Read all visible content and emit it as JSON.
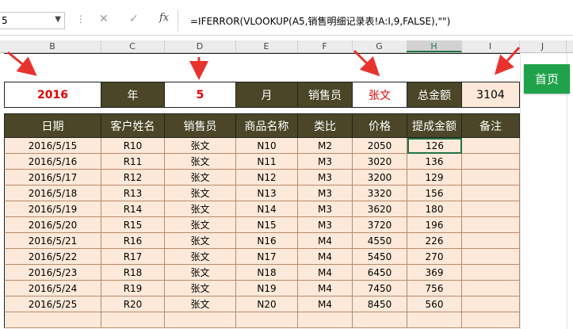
{
  "formula_bar": {
    "name_box": "5",
    "cancel_icon": "✕",
    "enter_icon": "✓",
    "fx_label": "fx",
    "formula": "=IFERROR(VLOOKUP(A5,销售明细记录表!A:I,9,FALSE),\"\")"
  },
  "columns": [
    "B",
    "C",
    "D",
    "E",
    "F",
    "G",
    "H",
    "I",
    "J"
  ],
  "selected_column": "H",
  "info_row": {
    "year_value": "2016",
    "year_label": "年",
    "month_value": "5",
    "month_label": "月",
    "seller_label": "销售员",
    "seller_value": "张文",
    "total_label": "总金额",
    "total_value": "3104"
  },
  "home_button": "首页",
  "table": {
    "headers": [
      "日期",
      "客户姓名",
      "销售员",
      "商品名称",
      "类比",
      "价格",
      "提成金额",
      "备注"
    ],
    "rows": [
      [
        "2016/5/15",
        "R10",
        "张文",
        "N10",
        "M2",
        "2050",
        "126",
        ""
      ],
      [
        "2016/5/16",
        "R11",
        "张文",
        "N11",
        "M3",
        "3020",
        "136",
        ""
      ],
      [
        "2016/5/17",
        "R12",
        "张文",
        "N12",
        "M3",
        "3200",
        "129",
        ""
      ],
      [
        "2016/5/18",
        "R13",
        "张文",
        "N13",
        "M3",
        "3320",
        "156",
        ""
      ],
      [
        "2016/5/19",
        "R14",
        "张文",
        "N14",
        "M3",
        "3620",
        "180",
        ""
      ],
      [
        "2016/5/20",
        "R15",
        "张文",
        "N15",
        "M3",
        "3720",
        "196",
        ""
      ],
      [
        "2016/5/21",
        "R16",
        "张文",
        "N16",
        "M4",
        "4550",
        "226",
        ""
      ],
      [
        "2016/5/22",
        "R17",
        "张文",
        "N17",
        "M4",
        "5450",
        "270",
        ""
      ],
      [
        "2016/5/23",
        "R18",
        "张文",
        "N18",
        "M4",
        "6450",
        "369",
        ""
      ],
      [
        "2016/5/24",
        "R19",
        "张文",
        "N19",
        "M4",
        "7450",
        "756",
        ""
      ],
      [
        "2016/5/25",
        "R20",
        "张文",
        "N20",
        "M4",
        "8450",
        "560",
        ""
      ],
      [
        "",
        "",
        "",
        "",
        "",
        "",
        "",
        ""
      ]
    ]
  },
  "colors": {
    "header_bg": "#4a4627",
    "row_bg": "#fde9d9",
    "accent_red": "#e00000",
    "excel_green": "#217346",
    "home_green": "#1fa24a"
  }
}
